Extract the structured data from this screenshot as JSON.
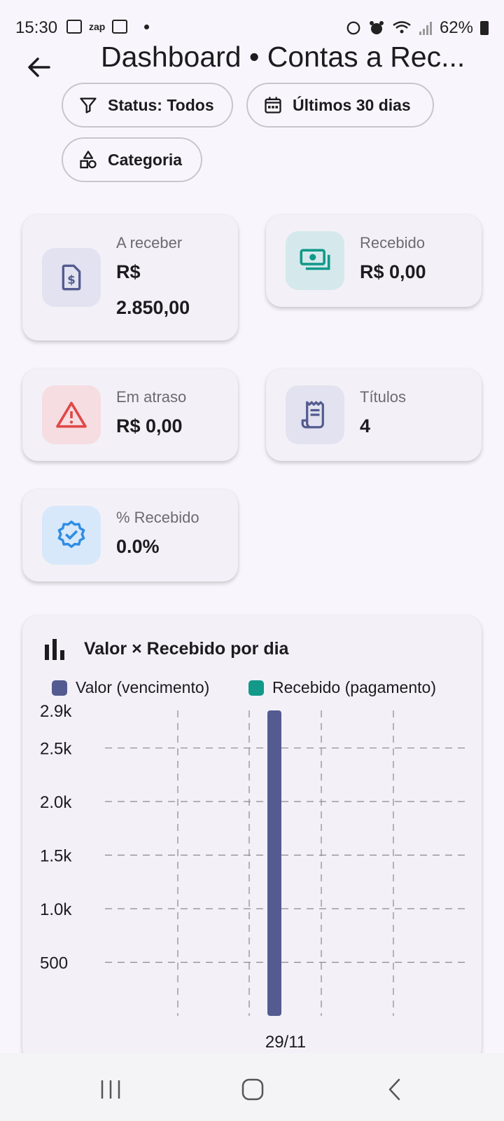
{
  "status_bar": {
    "time": "15:30",
    "zap_label": "zap",
    "battery": "62%"
  },
  "header": {
    "title": "Dashboard • Contas a Rec..."
  },
  "filters": {
    "status": "Status: Todos",
    "period": "Últimos 30 dias",
    "category": "Categoria"
  },
  "kpis": {
    "a_receber": {
      "label": "A receber",
      "value_line1": "R$",
      "value_line2": "2.850,00"
    },
    "recebido": {
      "label": "Recebido",
      "value": "R$ 0,00"
    },
    "em_atraso": {
      "label": "Em atraso",
      "value": "R$ 0,00"
    },
    "titulos": {
      "label": "Títulos",
      "value": "4"
    },
    "pct_recebido": {
      "label": "% Recebido",
      "value": "0.0%"
    }
  },
  "colors": {
    "valor": "#545b90",
    "recebido": "#12998a",
    "accent": "#545b90"
  },
  "chart_data": {
    "type": "bar",
    "title": "Valor × Recebido por dia",
    "categories": [
      "29/11"
    ],
    "series": [
      {
        "name": "Valor (vencimento)",
        "values": [
          2850
        ]
      },
      {
        "name": "Recebido (pagamento)",
        "values": [
          0
        ]
      }
    ],
    "y_ticks": [
      "500",
      "1.0k",
      "1.5k",
      "2.0k",
      "2.5k",
      "2.9k"
    ],
    "y_tick_values": [
      500,
      1000,
      1500,
      2000,
      2500,
      2900
    ],
    "ylim": [
      0,
      2850
    ],
    "grid": true,
    "legend_position": "top"
  }
}
